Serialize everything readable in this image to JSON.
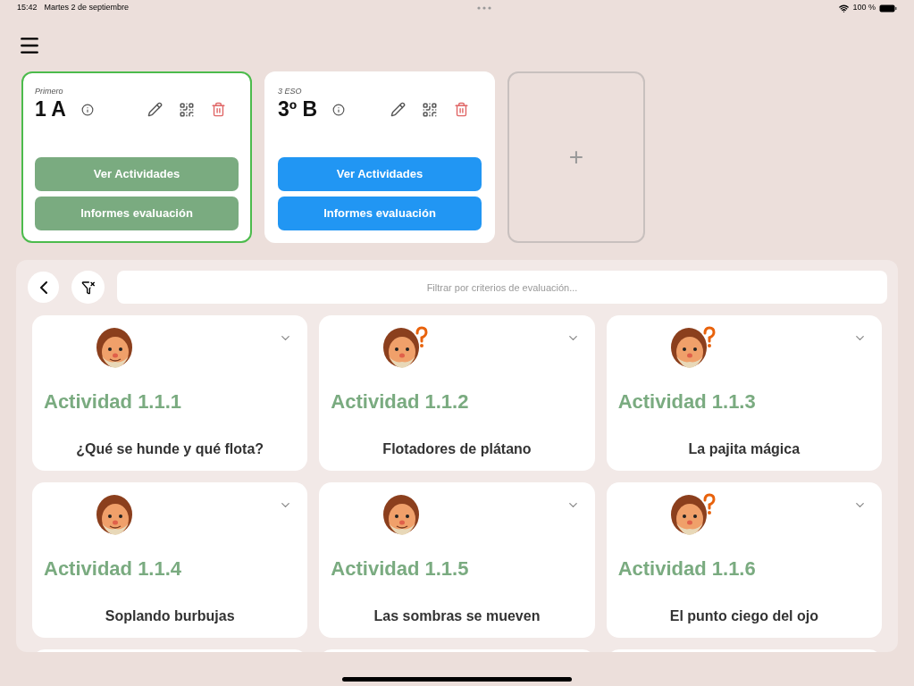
{
  "status_bar": {
    "time": "15:42",
    "date": "Martes 2 de septiembre",
    "battery": "100 %"
  },
  "groups": [
    {
      "course": "Primero",
      "name": "1 A",
      "selected": true,
      "buttons": [
        "Ver Actividades",
        "Informes evaluación"
      ]
    },
    {
      "course": "3 ESO",
      "name": "3º B",
      "selected": false,
      "buttons": [
        "Ver Actividades",
        "Informes evaluación"
      ]
    }
  ],
  "add_group": {
    "label": "+"
  },
  "filter": {
    "placeholder": "Filtrar por criterios de evaluación..."
  },
  "activities": [
    {
      "kind": "smiling",
      "title": "Actividad 1.1.1",
      "name": "¿Qué se hunde y qué flota?"
    },
    {
      "kind": "wondering",
      "title": "Actividad 1.1.2",
      "name": "Flotadores de plátano"
    },
    {
      "kind": "wondering",
      "title": "Actividad 1.1.3",
      "name": "La pajita mágica"
    },
    {
      "kind": "smiling",
      "title": "Actividad 1.1.4",
      "name": "Soplando burbujas"
    },
    {
      "kind": "smiling",
      "title": "Actividad 1.1.5",
      "name": "Las sombras se mueven"
    },
    {
      "kind": "wondering",
      "title": "Actividad 1.1.6",
      "name": "El punto ciego del ojo"
    }
  ]
}
